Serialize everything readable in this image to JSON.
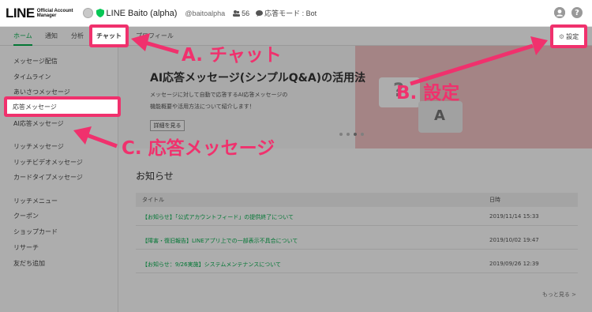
{
  "header": {
    "logo_main": "LINE",
    "logo_sub_1": "Official Account",
    "logo_sub_2": "Manager",
    "account_name": "LINE Baito (alpha)",
    "account_id": "@baitoalpha",
    "friends_count": "56",
    "response_mode": "応答モード : Bot"
  },
  "tabs": [
    {
      "label": "ホーム"
    },
    {
      "label": "通知"
    },
    {
      "label": "分析"
    },
    {
      "label": "チャット"
    },
    {
      "label": "プロフィール"
    }
  ],
  "settings_label": "設定",
  "sidebar": {
    "items": [
      {
        "label": "メッセージ配信"
      },
      {
        "label": "タイムライン"
      },
      {
        "label": "あいさつメッセージ"
      },
      {
        "label": "応答メッセージ"
      },
      {
        "label": "AI応答メッセージ"
      },
      {
        "label": "リッチメッセージ"
      },
      {
        "label": "リッチビデオメッセージ"
      },
      {
        "label": "カードタイプメッセージ"
      },
      {
        "label": "リッチメニュー"
      },
      {
        "label": "クーポン"
      },
      {
        "label": "ショップカード"
      },
      {
        "label": "リサーチ"
      },
      {
        "label": "友だち追加"
      }
    ]
  },
  "banner": {
    "title": "AI応答メッセージ(シンプルQ&A)の活用法",
    "desc_1": "メッセージに対して自動で応答するAI応答メッセージの",
    "desc_2": "機能概要や活用方法について紹介します！",
    "button": "詳細を見る",
    "icon_q": "?",
    "icon_a": "A"
  },
  "notice": {
    "title": "お知らせ",
    "col_title": "タイトル",
    "col_date": "日時",
    "rows": [
      {
        "title": "【お知らせ】「公式アカウントフィード」の提供終了について",
        "date": "2019/11/14 15:33"
      },
      {
        "title": "【障害・復旧報告】LINEアプリ上での一部表示不具合について",
        "date": "2019/10/02 19:47"
      },
      {
        "title": "【お知らせ：9/26実施】システムメンテナンスについて",
        "date": "2019/09/26 12:39"
      }
    ],
    "more": "もっと見る >"
  },
  "annotations": {
    "a": "A. チャット",
    "b": "B. 設定",
    "c": "C. 応答メッセージ",
    "color": "#f0316d"
  }
}
